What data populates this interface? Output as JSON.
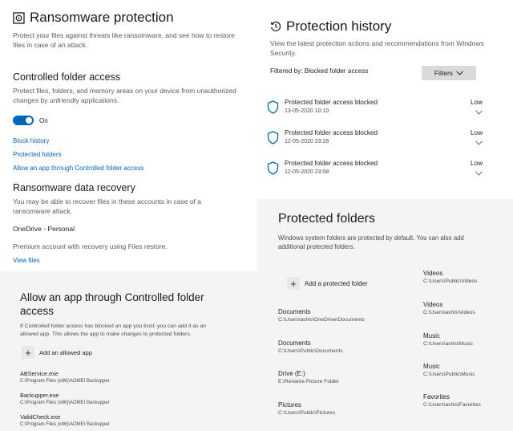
{
  "ransomware": {
    "title": "Ransomware protection",
    "description": "Protect your files against threats like ransomware, and see how to restore files in case of an attack.",
    "cfa_heading": "Controlled folder access",
    "cfa_description": "Protect files, folders, and memory areas on your device from unauthorized changes by unfriendly applications.",
    "toggle_label": "On",
    "links": [
      "Block history",
      "Protected folders",
      "Allow an app through Controlled folder access"
    ],
    "recovery_heading": "Ransomware data recovery",
    "recovery_description": "You may be able to recover files in these accounts in case of a ransomware attack.",
    "onedrive_label": "OneDrive - Personal",
    "premium_text": "Premium account with recovery using Files restore.",
    "view_files": "View files"
  },
  "history": {
    "title": "Protection history",
    "description": "View the latest protection actions and recommendations from Windows Security.",
    "filter_text": "Filtered by: Blocked folder access",
    "filters_button": "Filters",
    "items": [
      {
        "title": "Protected folder access blocked",
        "date": "13-05-2020 10:10",
        "severity": "Low"
      },
      {
        "title": "Protected folder access blocked",
        "date": "12-05-2020 23:28",
        "severity": "Low"
      },
      {
        "title": "Protected folder access blocked",
        "date": "12-05-2020 23:08",
        "severity": "Low"
      }
    ]
  },
  "allow_app": {
    "title_line1": "Allow an app through Controlled folder",
    "title_line2": "access",
    "description": "If Controlled folder access has blocked an app you trust, you can add it as an allowed app. This allows the app to make changes to protected folders.",
    "add_label": "Add an allowed app",
    "apps": [
      {
        "name": "ABService.exe",
        "path": "C:\\Program Files (x86)\\AOMEI Backupper"
      },
      {
        "name": "Backupper.exe",
        "path": "C:\\Program Files (x86)\\AOMEI Backupper"
      },
      {
        "name": "ValidCheck.exe",
        "path": "C:\\Program Files (x86)\\AOMEI Backupper"
      }
    ]
  },
  "protected_folders": {
    "title": "Protected folders",
    "description": "Windows system folders are protected by default. You can also add additional protected folders.",
    "add_label": "Add a protected folder",
    "left": [
      {
        "name": "Documents",
        "path": "C:\\Users\\ashis\\OneDrive\\Documents"
      },
      {
        "name": "Documents",
        "path": "C:\\Users\\Public\\Documents"
      },
      {
        "name": "Drive (E:)",
        "path": "E:\\Rename Picture Folder"
      },
      {
        "name": "Pictures",
        "path": "C:\\Users\\Public\\Pictures"
      }
    ],
    "right": [
      {
        "name": "Videos",
        "path": "C:\\Users\\Public\\Videos"
      },
      {
        "name": "Videos",
        "path": "C:\\Users\\ashis\\Videos"
      },
      {
        "name": "Music",
        "path": "C:\\Users\\ashis\\Music"
      },
      {
        "name": "Music",
        "path": "C:\\Users\\Public\\Music"
      },
      {
        "name": "Favorites",
        "path": "C:\\Users\\ashis\\Favorites"
      }
    ]
  }
}
